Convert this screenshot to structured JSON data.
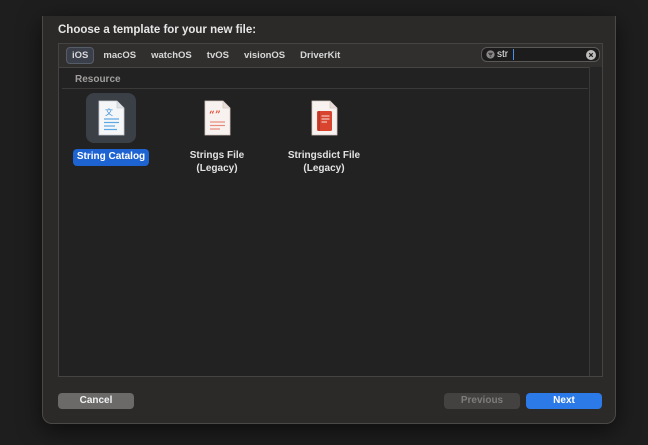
{
  "dialog": {
    "title": "Choose a template for your new file:"
  },
  "platform_tabs": [
    {
      "label": "iOS",
      "selected": true
    },
    {
      "label": "macOS",
      "selected": false
    },
    {
      "label": "watchOS",
      "selected": false
    },
    {
      "label": "tvOS",
      "selected": false
    },
    {
      "label": "visionOS",
      "selected": false
    },
    {
      "label": "DriverKit",
      "selected": false
    }
  ],
  "search": {
    "value": "str",
    "icon": "filter-icon",
    "clear_icon": "clear-icon"
  },
  "section": {
    "label": "Resource"
  },
  "templates": [
    {
      "line1": "String Catalog",
      "line2": "",
      "icon": "string-catalog-icon",
      "selected": true
    },
    {
      "line1": "Strings File",
      "line2": "(Legacy)",
      "icon": "strings-file-icon",
      "selected": false
    },
    {
      "line1": "Stringsdict File",
      "line2": "(Legacy)",
      "icon": "stringsdict-file-icon",
      "selected": false
    }
  ],
  "buttons": {
    "cancel": "Cancel",
    "previous": "Previous",
    "next": "Next",
    "previous_enabled": false
  },
  "colors": {
    "accent": "#2c79e8",
    "selection": "#1e63d2",
    "background": "#1f1e1e"
  }
}
